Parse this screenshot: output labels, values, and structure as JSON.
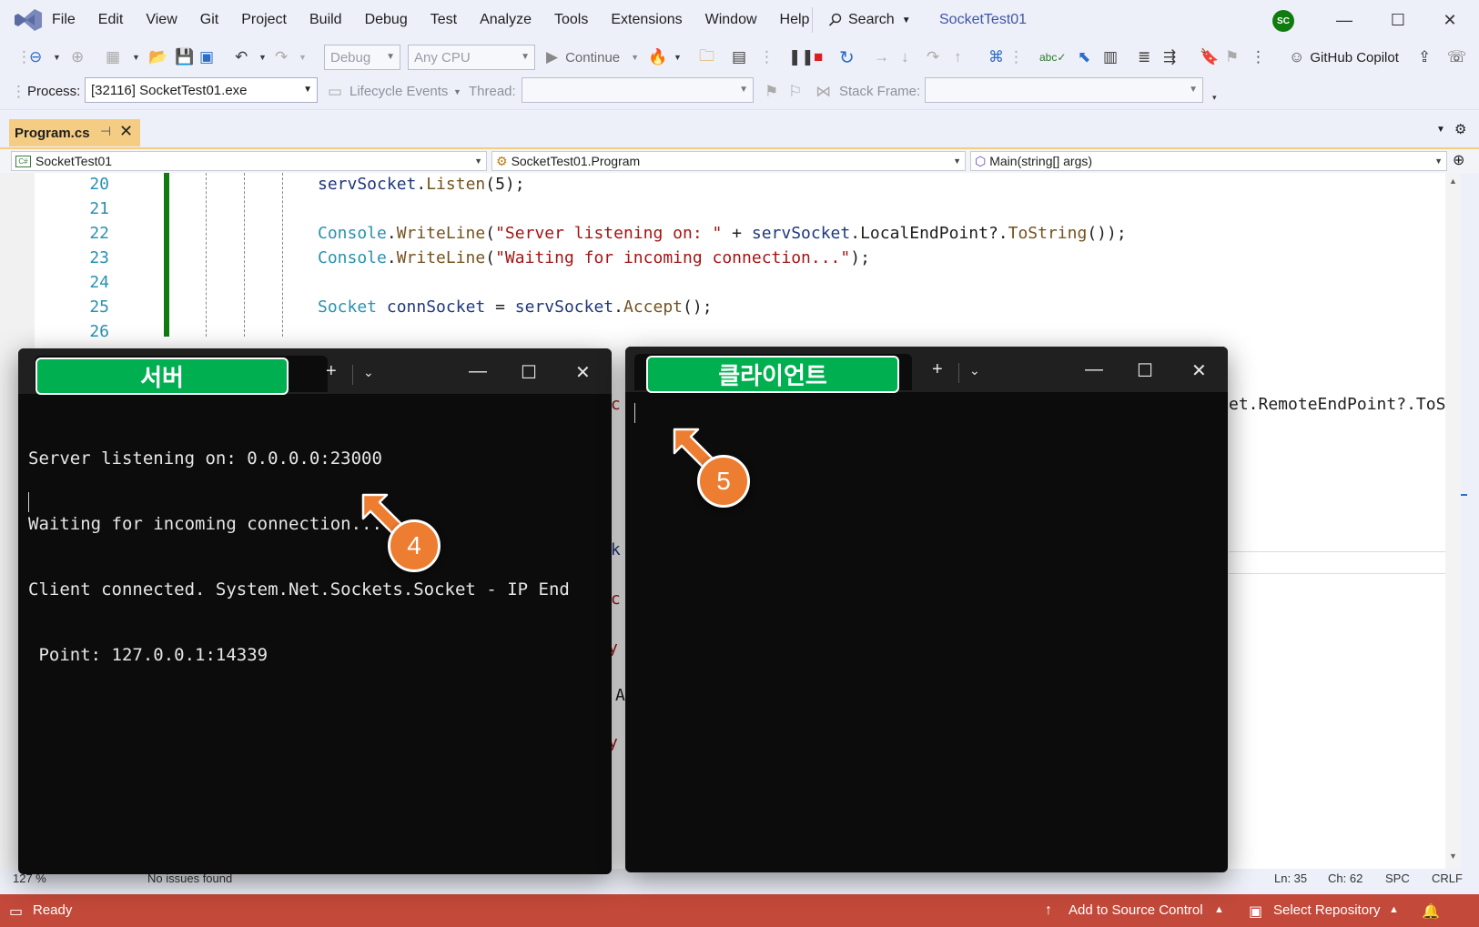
{
  "menubar": {
    "items": [
      "File",
      "Edit",
      "View",
      "Git",
      "Project",
      "Build",
      "Debug",
      "Test",
      "Analyze",
      "Tools",
      "Extensions",
      "Window",
      "Help"
    ],
    "search_label": "Search",
    "solution_title": "SocketTest01",
    "avatar_initials": "SC"
  },
  "toolbar1": {
    "config": "Debug",
    "platform": "Any CPU",
    "continue_label": "Continue",
    "copilot_label": "GitHub Copilot"
  },
  "toolbar2": {
    "process_label": "Process:",
    "process_value": "[32116] SocketTest01.exe",
    "lifecycle_label": "Lifecycle Events",
    "thread_label": "Thread:",
    "stackframe_label": "Stack Frame:"
  },
  "doc_tab": {
    "label": "Program.cs"
  },
  "navbar": {
    "project": "SocketTest01",
    "class": "SocketTest01.Program",
    "member": "Main(string[] args)"
  },
  "editor": {
    "line_numbers": [
      "20",
      "21",
      "22",
      "23",
      "24",
      "25",
      "26"
    ],
    "fragments": {
      "remote_endpoint": "et.RemoteEndPoint?.ToSt",
      "frag_ec1": "ec",
      "frag_ck": "ck",
      "frag_ec2": "ec",
      "frag_y1": "y",
      "frag_a": "A",
      "frag_y2": "y"
    }
  },
  "editor_status": {
    "zoom": "127 %",
    "issues": "No issues found",
    "line": "Ln: 35",
    "char": "Ch: 62",
    "spacing": "SPC",
    "line_ending": "CRLF"
  },
  "statusbar": {
    "ready": "Ready",
    "source_control": "Add to Source Control",
    "repository": "Select Repository"
  },
  "terminals": {
    "server": {
      "tab_label": "서버",
      "lines": [
        "Server listening on: 0.0.0.0:23000",
        "Waiting for incoming connection...",
        "Client connected. System.Net.Sockets.Socket - IP End",
        " Point: 127.0.0.1:14339"
      ]
    },
    "client": {
      "tab_label": "클라이언트",
      "lines": []
    }
  },
  "callouts": {
    "server": "4",
    "client": "5"
  },
  "colors": {
    "status_bar": "#c3493a",
    "tab_active": "#f5cc84",
    "terminal_label": "#00b050",
    "callout": "#ed7d31",
    "change_bar": "#107c10"
  }
}
